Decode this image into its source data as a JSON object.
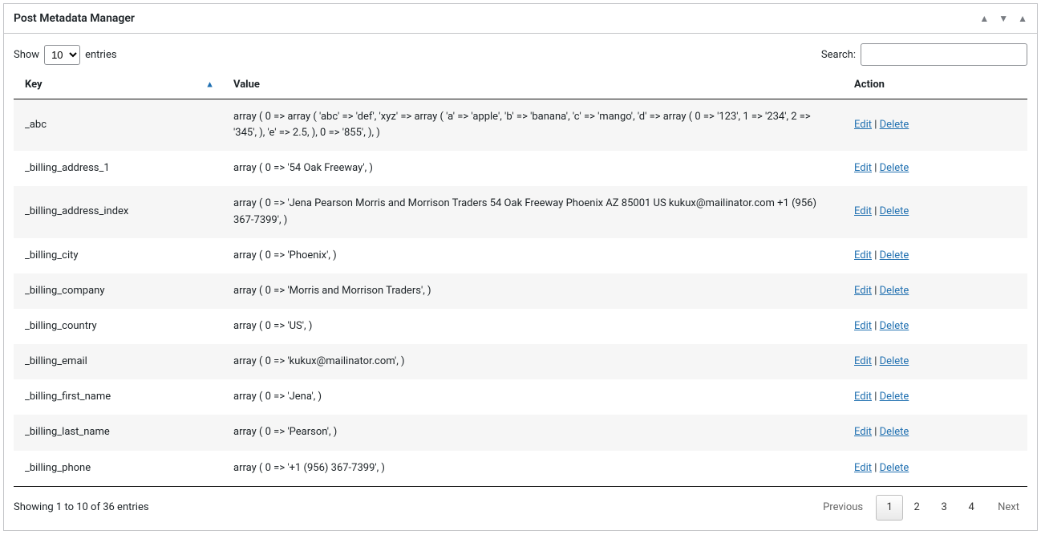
{
  "panel": {
    "title": "Post Metadata Manager"
  },
  "controls": {
    "show_prefix": "Show",
    "show_suffix": "entries",
    "show_value": "10",
    "search_label": "Search:"
  },
  "headers": {
    "key": "Key",
    "value": "Value",
    "action": "Action"
  },
  "actions": {
    "edit": "Edit",
    "delete": "Delete",
    "sep": " | "
  },
  "rows": [
    {
      "key": "_abc",
      "value": "array ( 0 => array ( 'abc' => 'def', 'xyz' => array ( 'a' => 'apple', 'b' => 'banana', 'c' => 'mango', 'd' => array ( 0 => '123', 1 => '234', 2 => '345', ), 'e' => 2.5, ), 0 => '855', ), )"
    },
    {
      "key": "_billing_address_1",
      "value": "array ( 0 => '54 Oak Freeway', )"
    },
    {
      "key": "_billing_address_index",
      "value": "array ( 0 => 'Jena Pearson Morris and Morrison Traders 54 Oak Freeway Phoenix AZ 85001 US kukux@mailinator.com +1 (956) 367-7399', )"
    },
    {
      "key": "_billing_city",
      "value": "array ( 0 => 'Phoenix', )"
    },
    {
      "key": "_billing_company",
      "value": "array ( 0 => 'Morris and Morrison Traders', )"
    },
    {
      "key": "_billing_country",
      "value": "array ( 0 => 'US', )"
    },
    {
      "key": "_billing_email",
      "value": "array ( 0 => 'kukux@mailinator.com', )"
    },
    {
      "key": "_billing_first_name",
      "value": "array ( 0 => 'Jena', )"
    },
    {
      "key": "_billing_last_name",
      "value": "array ( 0 => 'Pearson', )"
    },
    {
      "key": "_billing_phone",
      "value": "array ( 0 => '+1 (956) 367-7399', )"
    }
  ],
  "footer": {
    "info": "Showing 1 to 10 of 36 entries",
    "prev": "Previous",
    "next": "Next",
    "pages": [
      "1",
      "2",
      "3",
      "4"
    ],
    "current_page": "1"
  }
}
